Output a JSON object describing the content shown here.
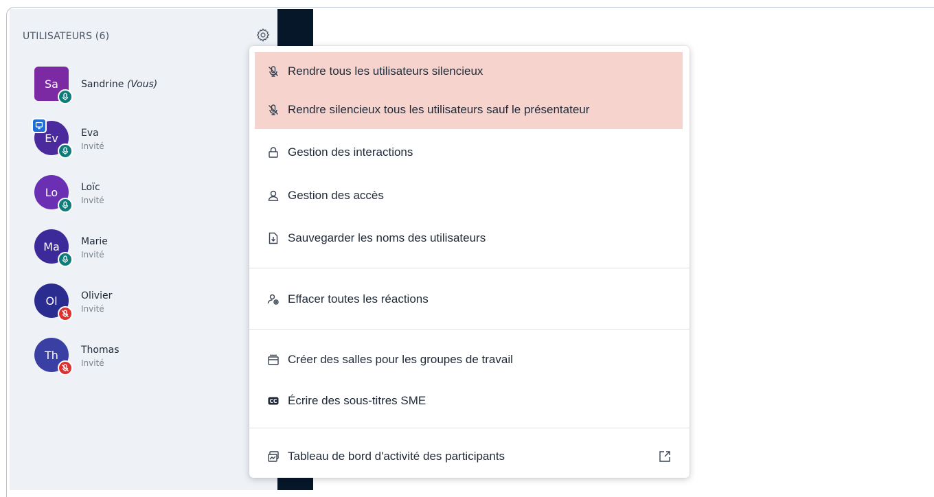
{
  "panel": {
    "title": "UTILISATEURS (6)",
    "settings_icon": "gear-icon"
  },
  "users": [
    {
      "initials": "Sa",
      "name": "Sandrine",
      "suffix": "(Vous)",
      "role": "",
      "color": "#7b2aa3",
      "shape": "square",
      "mic": "on",
      "presenter": false
    },
    {
      "initials": "Ev",
      "name": "Eva",
      "suffix": "",
      "role": "Invité",
      "color": "#4a2a9c",
      "shape": "round",
      "mic": "on",
      "presenter": true
    },
    {
      "initials": "Lo",
      "name": "Loïc",
      "suffix": "",
      "role": "Invité",
      "color": "#6b2fb3",
      "shape": "round",
      "mic": "on",
      "presenter": false
    },
    {
      "initials": "Ma",
      "name": "Marie",
      "suffix": "",
      "role": "Invité",
      "color": "#3d2a9a",
      "shape": "round",
      "mic": "on",
      "presenter": false
    },
    {
      "initials": "Ol",
      "name": "Olivier",
      "suffix": "",
      "role": "Invité",
      "color": "#2a2d8f",
      "shape": "round",
      "mic": "off",
      "presenter": false
    },
    {
      "initials": "Th",
      "name": "Thomas",
      "suffix": "",
      "role": "Invité",
      "color": "#3a3fa3",
      "shape": "round",
      "mic": "off",
      "presenter": false
    }
  ],
  "menu": {
    "items": [
      {
        "label": "Rendre tous les utilisateurs silencieux",
        "icon": "mute-mic-icon",
        "highlight": true
      },
      {
        "label": "Rendre silencieux tous les utilisateurs sauf le présentateur",
        "icon": "mute-mic-icon",
        "highlight": true
      },
      {
        "label": "Gestion des interactions",
        "icon": "lock-icon",
        "highlight": false
      },
      {
        "label": "Gestion des accès",
        "icon": "user-icon",
        "highlight": false
      },
      {
        "label": "Sauvegarder les noms des utilisateurs",
        "icon": "download-file-icon",
        "highlight": false
      },
      {
        "label": "Effacer toutes les réactions",
        "icon": "clear-reactions-icon",
        "highlight": false
      },
      {
        "label": "Créer des salles pour les groupes de travail",
        "icon": "rooms-icon",
        "highlight": false
      },
      {
        "label": "Écrire des sous-titres SME",
        "icon": "closed-captions-icon",
        "highlight": false
      },
      {
        "label": "Tableau de bord d'activité des participants",
        "icon": "dashboard-icon",
        "highlight": false,
        "external_icon": "external-link-icon"
      }
    ]
  },
  "colors": {
    "highlight": "#f6d3cc",
    "panel_bg": "#eef2f6",
    "mic_on": "#0f7c7c",
    "mic_off": "#dd3131",
    "presenter": "#1d6fd6",
    "sidebar_dark": "#06172a"
  }
}
